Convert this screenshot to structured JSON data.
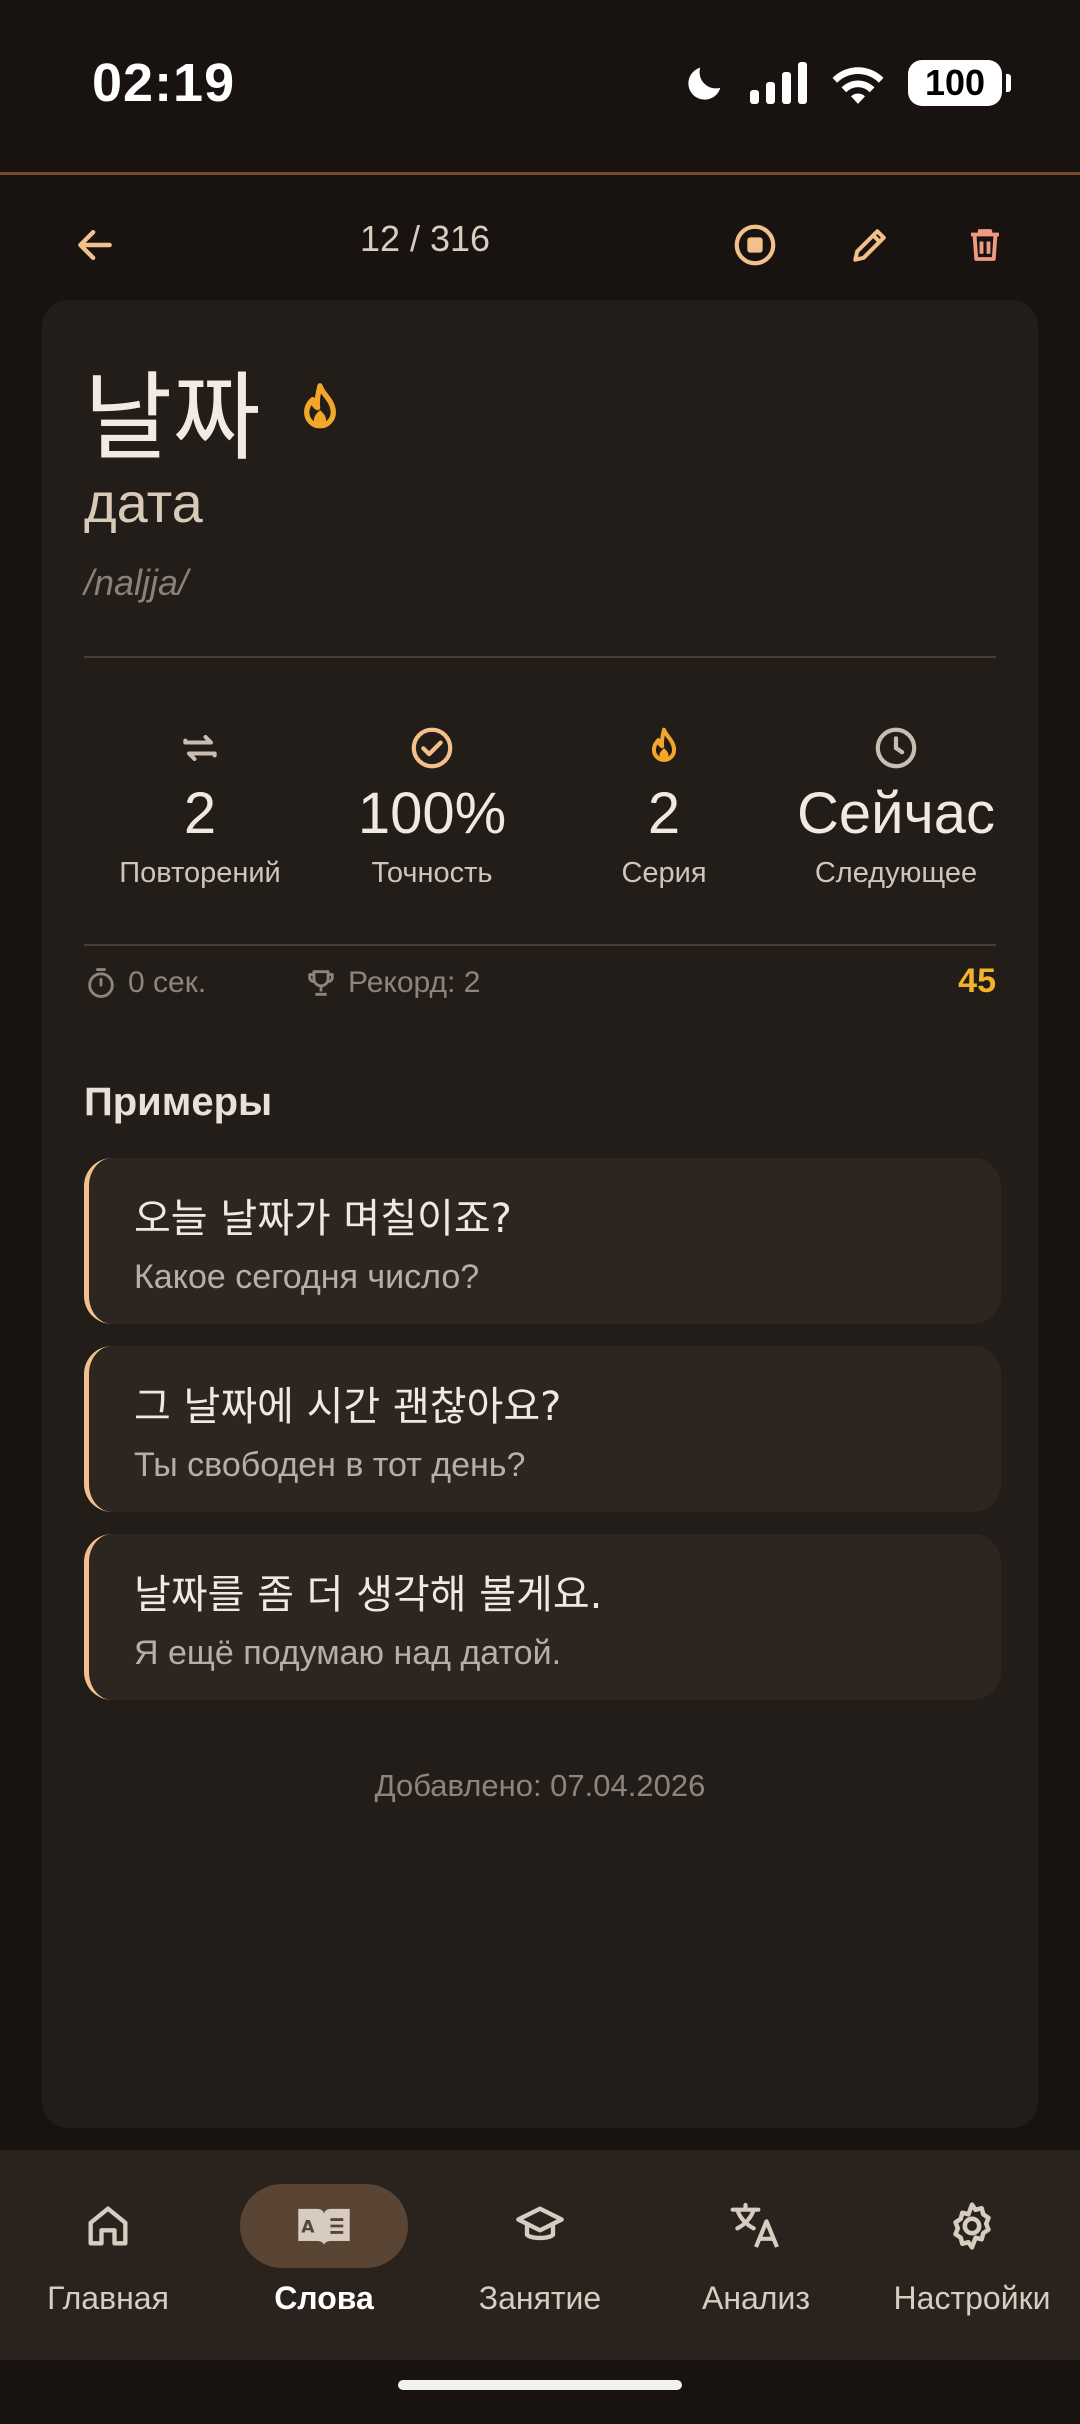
{
  "status_bar": {
    "time": "02:19",
    "battery": "100"
  },
  "toolbar": {
    "counter": "12 / 316"
  },
  "word": {
    "korean": "날짜",
    "translation": "дата",
    "transliteration": "/naljja/"
  },
  "stats": [
    {
      "icon": "repeat-icon",
      "value": "2",
      "label": "Повторений"
    },
    {
      "icon": "check-circle-icon",
      "value": "100%",
      "label": "Точность"
    },
    {
      "icon": "flame-icon",
      "value": "2",
      "label": "Серия"
    },
    {
      "icon": "clock-icon",
      "value": "Сейчас",
      "label": "Следующее"
    }
  ],
  "meta": {
    "time": "0 сек.",
    "record": "Рекорд: 2",
    "score": "45"
  },
  "examples_title": "Примеры",
  "examples": [
    {
      "ko": "오늘 날짜가 며칠이죠?",
      "ru": "Какое сегодня число?"
    },
    {
      "ko": "그 날짜에 시간 괜찮아요?",
      "ru": "Ты свободен в тот день?"
    },
    {
      "ko": "날짜를 좀 더 생각해 볼게요.",
      "ru": "Я ещё подумаю над датой."
    }
  ],
  "added": "Добавлено: 07.04.2026",
  "nav": [
    {
      "icon": "home-icon",
      "label": "Главная"
    },
    {
      "icon": "book-icon",
      "label": "Слова"
    },
    {
      "icon": "graduation-cap-icon",
      "label": "Занятие"
    },
    {
      "icon": "translate-icon",
      "label": "Анализ"
    },
    {
      "icon": "gear-icon",
      "label": "Настройки"
    }
  ],
  "colors": {
    "accent": "#f3c08c",
    "flame": "#f2a72a",
    "score": "#f2b32a",
    "card": "#231d19",
    "background": "#181310"
  }
}
